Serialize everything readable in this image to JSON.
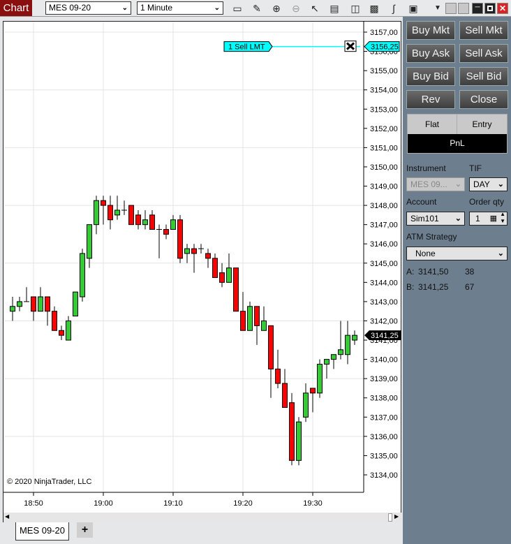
{
  "toolbar": {
    "title": "Chart",
    "instrument": "MES 09-20",
    "interval": "1 Minute",
    "icons": [
      "bar-type-icon",
      "drawing-tools-icon",
      "zoom-in-icon",
      "zoom-out-icon",
      "pointer-icon",
      "data-box-icon",
      "chart-trader-icon",
      "indicators-icon",
      "strategies-icon",
      "properties-icon"
    ]
  },
  "chart": {
    "copyright": "© 2020 NinjaTrader, LLC",
    "time_labels": [
      "18:50",
      "19:00",
      "19:10",
      "19:20",
      "19:30"
    ],
    "order": {
      "label": "1  Sell LMT",
      "price": "3156,25",
      "quantity": 1,
      "side": "Sell",
      "type": "LMT"
    },
    "last_price": "3141,25",
    "colors": {
      "up": "#33cc33",
      "down": "#ff0000",
      "order_line": "#00ffff"
    }
  },
  "chart_data": {
    "type": "candlestick",
    "x_start": "18:47",
    "interval_minutes": 1,
    "ylim": [
      3133.5,
      3157.5
    ],
    "y_ticks": [
      "3157,00",
      "3156,00",
      "3155,00",
      "3154,00",
      "3153,00",
      "3152,00",
      "3151,00",
      "3150,00",
      "3149,00",
      "3148,00",
      "3147,00",
      "3146,00",
      "3145,00",
      "3144,00",
      "3143,00",
      "3142,00",
      "3141,00",
      "3140,00",
      "3139,00",
      "3138,00",
      "3137,00",
      "3136,00",
      "3135,00",
      "3134,00"
    ],
    "ohlc": [
      [
        3142.5,
        3143.25,
        3142.0,
        3142.75
      ],
      [
        3142.75,
        3143.25,
        3142.5,
        3143.0
      ],
      [
        3143.0,
        3143.75,
        3143.0,
        3143.0
      ],
      [
        3143.25,
        3143.25,
        3142.0,
        3142.5
      ],
      [
        3142.5,
        3143.75,
        3142.5,
        3143.25
      ],
      [
        3143.25,
        3143.25,
        3141.75,
        3142.5
      ],
      [
        3142.5,
        3142.75,
        3141.5,
        3141.5
      ],
      [
        3141.5,
        3141.75,
        3141.0,
        3141.25
      ],
      [
        3141.0,
        3142.25,
        3141.0,
        3142.0
      ],
      [
        3142.25,
        3143.5,
        3142.25,
        3143.5
      ],
      [
        3143.25,
        3145.75,
        3143.0,
        3145.5
      ],
      [
        3145.25,
        3147.0,
        3144.75,
        3147.0
      ],
      [
        3147.0,
        3148.5,
        3146.5,
        3148.25
      ],
      [
        3148.25,
        3148.5,
        3147.0,
        3148.0
      ],
      [
        3148.0,
        3148.5,
        3146.75,
        3147.25
      ],
      [
        3147.5,
        3148.5,
        3147.25,
        3147.75
      ],
      [
        3147.75,
        3148.25,
        3147.5,
        3147.75
      ],
      [
        3148.0,
        3148.0,
        3147.0,
        3147.0
      ],
      [
        3147.5,
        3147.75,
        3146.75,
        3147.0
      ],
      [
        3147.0,
        3147.75,
        3146.75,
        3147.25
      ],
      [
        3147.5,
        3147.75,
        3146.75,
        3146.75
      ],
      [
        3146.75,
        3147.0,
        3145.25,
        3146.75
      ],
      [
        3146.75,
        3147.0,
        3146.25,
        3146.5
      ],
      [
        3146.75,
        3147.5,
        3146.75,
        3147.25
      ],
      [
        3147.25,
        3147.5,
        3145.0,
        3145.25
      ],
      [
        3145.5,
        3146.0,
        3145.0,
        3145.75
      ],
      [
        3145.75,
        3146.0,
        3144.5,
        3145.5
      ],
      [
        3145.75,
        3146.0,
        3145.5,
        3145.75
      ],
      [
        3145.5,
        3145.75,
        3144.75,
        3145.25
      ],
      [
        3145.25,
        3145.5,
        3144.25,
        3144.25
      ],
      [
        3144.5,
        3145.0,
        3143.75,
        3144.0
      ],
      [
        3144.0,
        3145.5,
        3144.0,
        3144.75
      ],
      [
        3144.75,
        3144.75,
        3142.5,
        3142.5
      ],
      [
        3142.5,
        3143.5,
        3141.5,
        3141.5
      ],
      [
        3141.5,
        3143.0,
        3141.5,
        3142.75
      ],
      [
        3142.75,
        3142.75,
        3140.75,
        3141.75
      ],
      [
        3141.5,
        3142.75,
        3141.5,
        3142.0
      ],
      [
        3141.75,
        3141.75,
        3138.0,
        3139.5
      ],
      [
        3139.5,
        3140.5,
        3138.5,
        3138.75
      ],
      [
        3138.75,
        3139.5,
        3137.5,
        3137.5
      ],
      [
        3137.75,
        3138.25,
        3134.5,
        3134.75
      ],
      [
        3134.75,
        3137.0,
        3134.5,
        3136.75
      ],
      [
        3137.0,
        3138.75,
        3136.75,
        3138.25
      ],
      [
        3138.5,
        3138.5,
        3137.25,
        3138.25
      ],
      [
        3138.25,
        3140.0,
        3138.0,
        3139.75
      ],
      [
        3139.75,
        3140.0,
        3139.0,
        3140.0
      ],
      [
        3140.0,
        3140.25,
        3139.5,
        3140.25
      ],
      [
        3140.25,
        3142.0,
        3140.0,
        3140.5
      ],
      [
        3140.25,
        3142.0,
        3139.75,
        3141.25
      ],
      [
        3141.0,
        3141.5,
        3140.75,
        3141.25
      ]
    ]
  },
  "tabs": {
    "active": "MES 09-20",
    "add": "+"
  },
  "trader": {
    "buttons": [
      "Buy Mkt",
      "Sell Mkt",
      "Buy Ask",
      "Sell Ask",
      "Buy Bid",
      "Sell Bid",
      "Rev",
      "Close"
    ],
    "position": {
      "flat": "Flat",
      "entry": "Entry",
      "pnl": "PnL"
    },
    "instrument_label": "Instrument",
    "instrument_value": "MES 09...",
    "tif_label": "TIF",
    "tif_value": "DAY",
    "account_label": "Account",
    "account_value": "Sim101",
    "qty_label": "Order qty",
    "qty_value": "1",
    "atm_label": "ATM Strategy",
    "atm_value": "None",
    "ask": {
      "label": "A:",
      "price": "3141,50",
      "size": "38"
    },
    "bid": {
      "label": "B:",
      "price": "3141,25",
      "size": "67"
    }
  }
}
